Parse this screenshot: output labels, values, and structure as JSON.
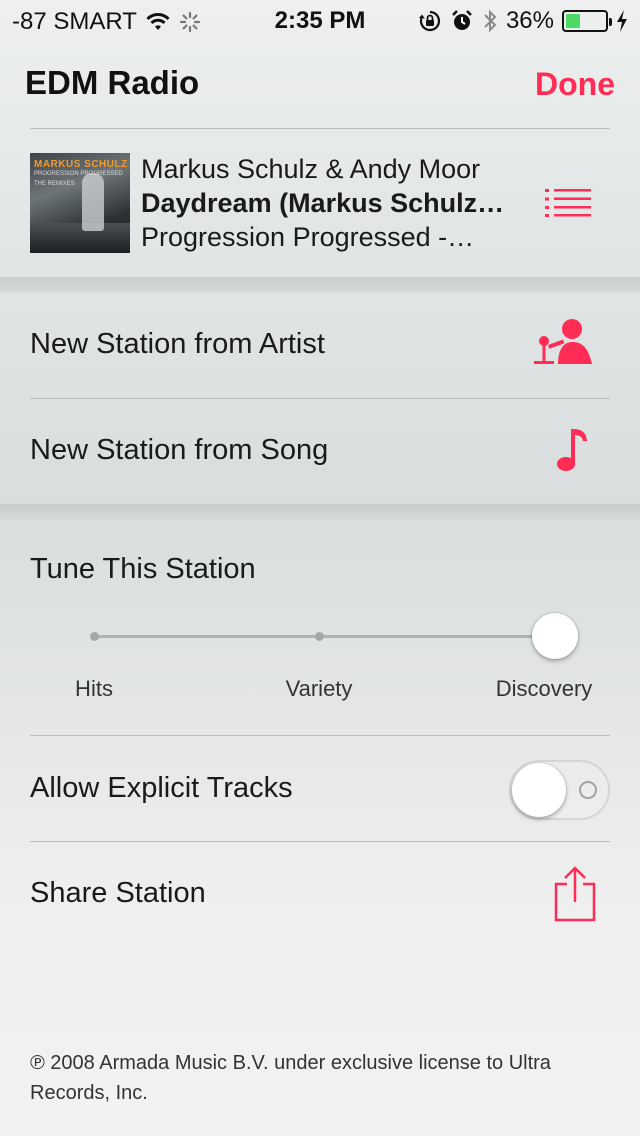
{
  "status_bar": {
    "carrier": "-87 SMART",
    "time": "2:35 PM",
    "battery": "36%",
    "battery_level": 0.36,
    "icons": [
      "wifi-icon",
      "activity-spinner-icon",
      "orientation-lock-icon",
      "alarm-icon",
      "bluetooth-icon",
      "battery-icon",
      "charging-bolt-icon"
    ]
  },
  "header": {
    "title": "EDM Radio",
    "done_label": "Done"
  },
  "now_playing": {
    "artist": "Markus Schulz & Andy Moor",
    "track": "Daydream (Markus Schulz…",
    "album": "Progression Progressed -…",
    "artwork": {
      "artist_text": "MARKUS SCHULZ",
      "title_text": "PROGRESSION PROGRESSED",
      "subtitle_text": "THE REMIXES"
    },
    "list_icon": "track-list-icon"
  },
  "actions": {
    "new_from_artist": "New Station from Artist",
    "new_from_song": "New Station from Song"
  },
  "tune": {
    "title": "Tune This Station",
    "options": [
      "Hits",
      "Variety",
      "Discovery"
    ],
    "selected": "Discovery"
  },
  "explicit": {
    "label": "Allow Explicit Tracks",
    "enabled": false
  },
  "share": {
    "label": "Share Station"
  },
  "footer": {
    "copyright": "℗ 2008 Armada Music B.V. under exclusive license to Ultra Records, Inc."
  },
  "colors": {
    "accent": "#ff2d55",
    "battery_fill": "#4cd964"
  }
}
